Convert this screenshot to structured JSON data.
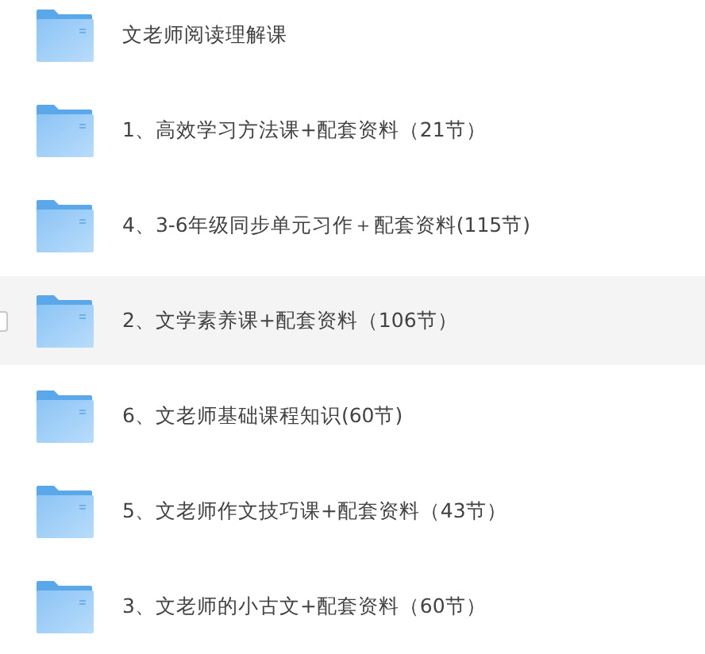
{
  "folders": [
    {
      "name": "文老师阅读理解课",
      "hovered": false
    },
    {
      "name": "1、高效学习方法课+配套资料（21节）",
      "hovered": false
    },
    {
      "name": "4、3-6年级同步单元习作＋配套资料(115节)",
      "hovered": false
    },
    {
      "name": "2、文学素养课+配套资料（106节）",
      "hovered": true
    },
    {
      "name": "6、文老师基础课程知识(60节)",
      "hovered": false
    },
    {
      "name": "5、文老师作文技巧课+配套资料（43节）",
      "hovered": false
    },
    {
      "name": "3、文老师的小古文+配套资料（60节）",
      "hovered": false
    }
  ]
}
